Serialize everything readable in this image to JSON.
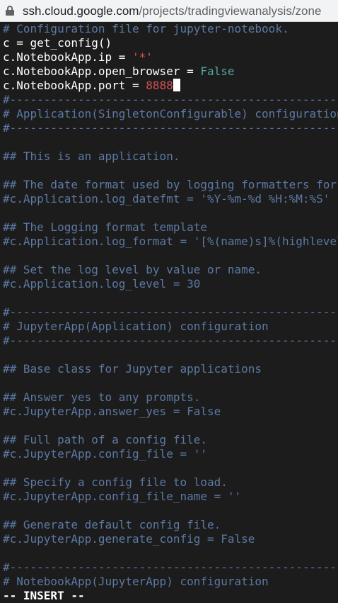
{
  "browser": {
    "url_host": "ssh.cloud.google.com",
    "url_path": "/projects/tradingviewanalysis/zone",
    "lock_icon": "lock-icon"
  },
  "editor": {
    "mode": "-- INSERT --",
    "lines": [
      [
        {
          "t": "# Configuration file for jupyter-notebook.",
          "c": "c"
        }
      ],
      [
        {
          "t": "c = get_config()",
          "c": "w"
        }
      ],
      [
        {
          "t": "c.NotebookApp.ip = ",
          "c": "w"
        },
        {
          "t": "'*'",
          "c": "s"
        }
      ],
      [
        {
          "t": "c.NotebookApp.open_browser = ",
          "c": "w"
        },
        {
          "t": "False",
          "c": "k"
        }
      ],
      [
        {
          "t": "c.NotebookApp.port = ",
          "c": "w"
        },
        {
          "t": "8888",
          "c": "n",
          "cursor": true
        }
      ],
      [
        {
          "t": "#------------------------------------------------------------------",
          "c": "c"
        }
      ],
      [
        {
          "t": "# Application(SingletonConfigurable) configuration",
          "c": "c"
        }
      ],
      [
        {
          "t": "#------------------------------------------------------------------",
          "c": "c"
        }
      ],
      [],
      [
        {
          "t": "## This is an application.",
          "c": "c"
        }
      ],
      [],
      [
        {
          "t": "## The date format used by logging formatters for %(asctime)s",
          "c": "c"
        }
      ],
      [
        {
          "t": "#c.Application.log_datefmt = '%Y-%m-%d %H:%M:%S'",
          "c": "c"
        }
      ],
      [],
      [
        {
          "t": "## The Logging format template",
          "c": "c"
        }
      ],
      [
        {
          "t": "#c.Application.log_format = '[%(name)s]%(highlevel)s %(message)s'",
          "c": "c"
        }
      ],
      [],
      [
        {
          "t": "## Set the log level by value or name.",
          "c": "c"
        }
      ],
      [
        {
          "t": "#c.Application.log_level = 30",
          "c": "c"
        }
      ],
      [],
      [
        {
          "t": "#------------------------------------------------------------------",
          "c": "c"
        }
      ],
      [
        {
          "t": "# JupyterApp(Application) configuration",
          "c": "c"
        }
      ],
      [
        {
          "t": "#------------------------------------------------------------------",
          "c": "c"
        }
      ],
      [],
      [
        {
          "t": "## Base class for Jupyter applications",
          "c": "c"
        }
      ],
      [],
      [
        {
          "t": "## Answer yes to any prompts.",
          "c": "c"
        }
      ],
      [
        {
          "t": "#c.JupyterApp.answer_yes = False",
          "c": "c"
        }
      ],
      [],
      [
        {
          "t": "## Full path of a config file.",
          "c": "c"
        }
      ],
      [
        {
          "t": "#c.JupyterApp.config_file = ''",
          "c": "c"
        }
      ],
      [],
      [
        {
          "t": "## Specify a config file to load.",
          "c": "c"
        }
      ],
      [
        {
          "t": "#c.JupyterApp.config_file_name = ''",
          "c": "c"
        }
      ],
      [],
      [
        {
          "t": "## Generate default config file.",
          "c": "c"
        }
      ],
      [
        {
          "t": "#c.JupyterApp.generate_config = False",
          "c": "c"
        }
      ],
      [],
      [
        {
          "t": "#------------------------------------------------------------------",
          "c": "c"
        }
      ],
      [
        {
          "t": "# NotebookApp(JupyterApp) configuration",
          "c": "c"
        }
      ]
    ]
  }
}
